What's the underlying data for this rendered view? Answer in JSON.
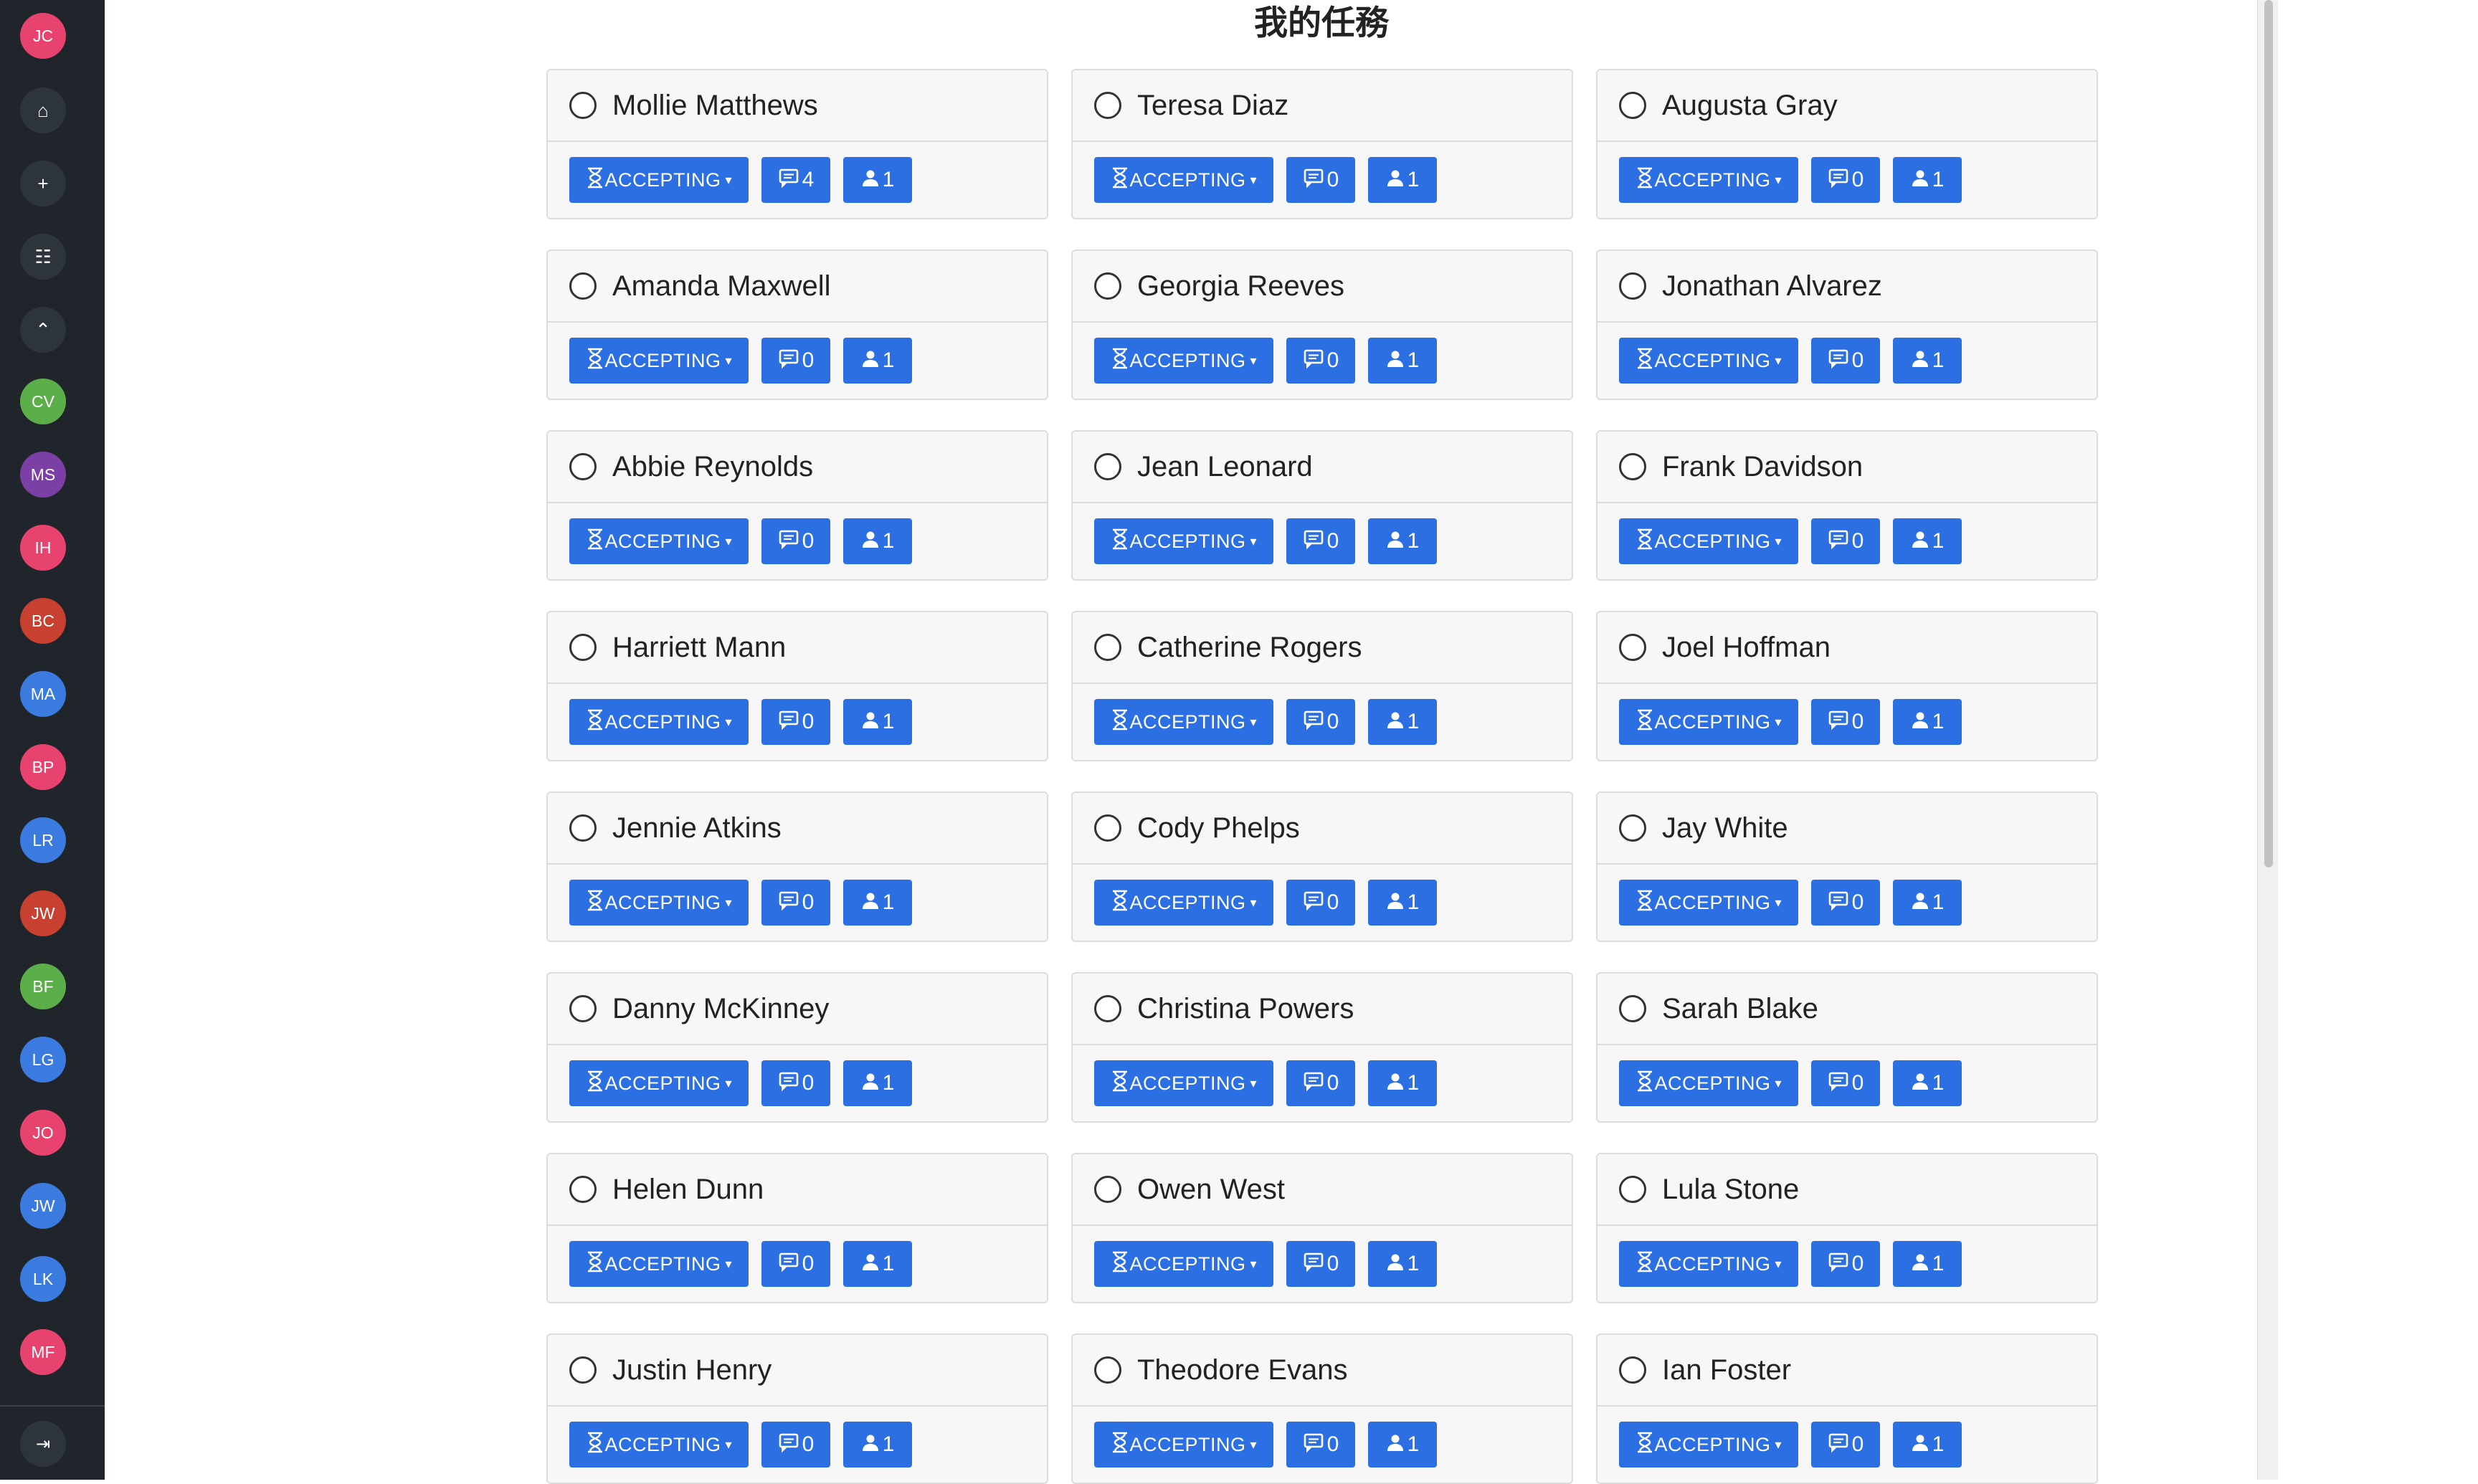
{
  "user": {
    "initials": "JC",
    "color": "#e8436f"
  },
  "nav": [
    {
      "name": "home-icon",
      "glyph": "⌂"
    },
    {
      "name": "plus-icon",
      "glyph": "+"
    },
    {
      "name": "task-list-icon",
      "glyph": "☷"
    },
    {
      "name": "chevron-up-icon",
      "glyph": "⌃"
    }
  ],
  "members": [
    {
      "initials": "CV",
      "color": "#5cae4a"
    },
    {
      "initials": "MS",
      "color": "#7b3fa6"
    },
    {
      "initials": "IH",
      "color": "#e8436f"
    },
    {
      "initials": "BC",
      "color": "#c8402f"
    },
    {
      "initials": "MA",
      "color": "#3b7be0"
    },
    {
      "initials": "BP",
      "color": "#e8436f"
    },
    {
      "initials": "LR",
      "color": "#3b7be0"
    },
    {
      "initials": "JW",
      "color": "#c8402f"
    },
    {
      "initials": "BF",
      "color": "#5cae4a"
    },
    {
      "initials": "LG",
      "color": "#3b7be0"
    },
    {
      "initials": "JO",
      "color": "#e8436f"
    },
    {
      "initials": "JW",
      "color": "#3b7be0"
    },
    {
      "initials": "LK",
      "color": "#3b7be0"
    },
    {
      "initials": "MF",
      "color": "#e8436f"
    }
  ],
  "collapse_icon": "⇥",
  "page_title": "我的任務",
  "status_label": "ACCEPTING",
  "tasks": [
    {
      "name": "Mollie Matthews",
      "comments": "4",
      "assignees": "1"
    },
    {
      "name": "Teresa Diaz",
      "comments": "0",
      "assignees": "1"
    },
    {
      "name": "Augusta Gray",
      "comments": "0",
      "assignees": "1"
    },
    {
      "name": "Amanda Maxwell",
      "comments": "0",
      "assignees": "1"
    },
    {
      "name": "Georgia Reeves",
      "comments": "0",
      "assignees": "1"
    },
    {
      "name": "Jonathan Alvarez",
      "comments": "0",
      "assignees": "1"
    },
    {
      "name": "Abbie Reynolds",
      "comments": "0",
      "assignees": "1"
    },
    {
      "name": "Jean Leonard",
      "comments": "0",
      "assignees": "1"
    },
    {
      "name": "Frank Davidson",
      "comments": "0",
      "assignees": "1"
    },
    {
      "name": "Harriett Mann",
      "comments": "0",
      "assignees": "1"
    },
    {
      "name": "Catherine Rogers",
      "comments": "0",
      "assignees": "1"
    },
    {
      "name": "Joel Hoffman",
      "comments": "0",
      "assignees": "1"
    },
    {
      "name": "Jennie Atkins",
      "comments": "0",
      "assignees": "1"
    },
    {
      "name": "Cody Phelps",
      "comments": "0",
      "assignees": "1"
    },
    {
      "name": "Jay White",
      "comments": "0",
      "assignees": "1"
    },
    {
      "name": "Danny McKinney",
      "comments": "0",
      "assignees": "1"
    },
    {
      "name": "Christina Powers",
      "comments": "0",
      "assignees": "1"
    },
    {
      "name": "Sarah Blake",
      "comments": "0",
      "assignees": "1"
    },
    {
      "name": "Helen Dunn",
      "comments": "0",
      "assignees": "1"
    },
    {
      "name": "Owen West",
      "comments": "0",
      "assignees": "1"
    },
    {
      "name": "Lula Stone",
      "comments": "0",
      "assignees": "1"
    },
    {
      "name": "Justin Henry",
      "comments": "0",
      "assignees": "1"
    },
    {
      "name": "Theodore Evans",
      "comments": "0",
      "assignees": "1"
    },
    {
      "name": "Ian Foster",
      "comments": "0",
      "assignees": "1"
    }
  ]
}
